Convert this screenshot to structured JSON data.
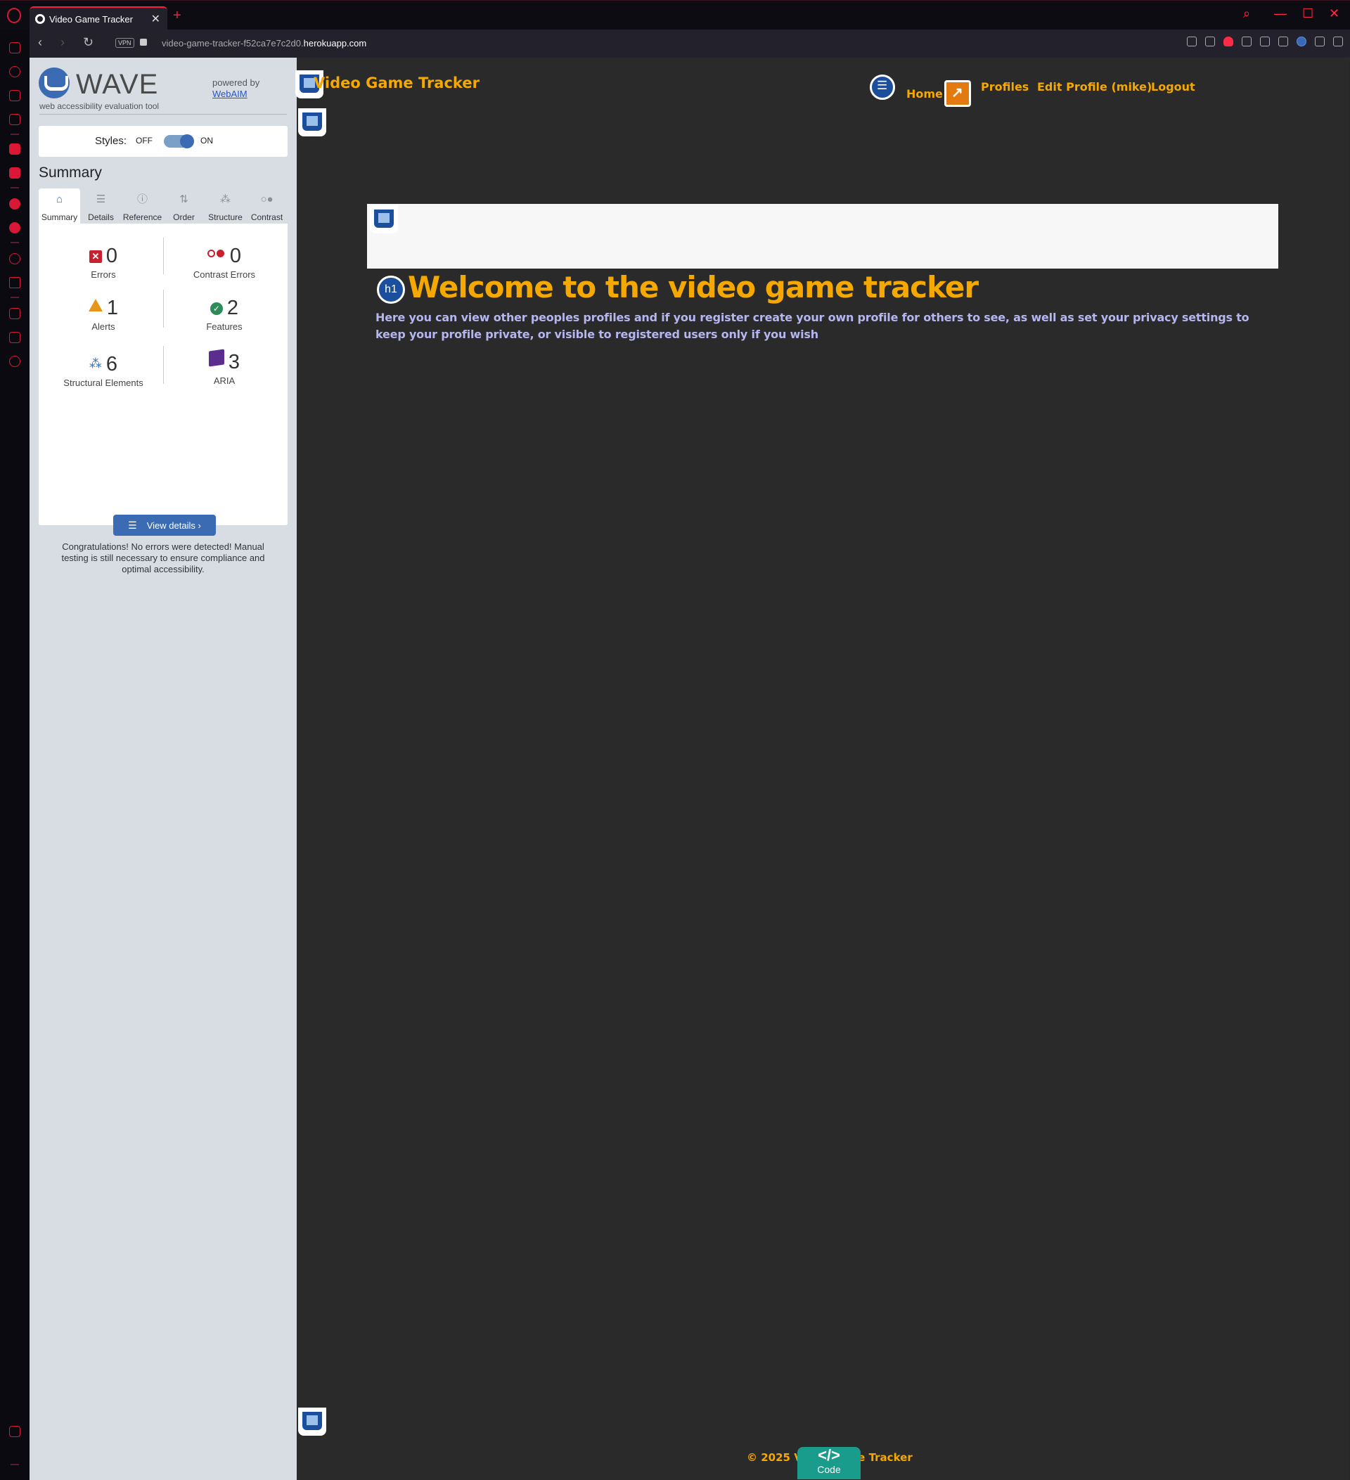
{
  "browser": {
    "tab_title": "Video Game Tracker",
    "tab_close": "✕",
    "new_tab": "+",
    "url_prefix": "video-game-tracker-f52ca7e7c2d0.",
    "url_domain": "herokuapp.com",
    "vpn_label": "VPN",
    "back": "‹",
    "forward": "›",
    "reload": "↻",
    "win_search": "⌕",
    "win_min": "—",
    "win_max": "☐",
    "win_close": "✕",
    "accent": "#ff1b3d"
  },
  "wave": {
    "title": "WAVE",
    "subtitle": "web accessibility evaluation tool",
    "powered_by": "powered by",
    "webaim": "WebAIM",
    "styles_label": "Styles:",
    "styles_off": "OFF",
    "styles_on": "ON",
    "summary_heading": "Summary",
    "tabs": [
      {
        "label": "Summary",
        "icon": "home-icon",
        "glyph": "⌂"
      },
      {
        "label": "Details",
        "icon": "list-icon",
        "glyph": "☰"
      },
      {
        "label": "Reference",
        "icon": "info-icon",
        "glyph": "ⓘ"
      },
      {
        "label": "Order",
        "icon": "order-icon",
        "glyph": "⇅"
      },
      {
        "label": "Structure",
        "icon": "structure-icon",
        "glyph": "⁂"
      },
      {
        "label": "Contrast",
        "icon": "contrast-icon",
        "glyph": "○●"
      }
    ],
    "stats": {
      "errors": {
        "value": "0",
        "label": "Errors",
        "icon_glyph": "✕"
      },
      "contrast_errors": {
        "value": "0",
        "label": "Contrast Errors"
      },
      "alerts": {
        "value": "1",
        "label": "Alerts"
      },
      "features": {
        "value": "2",
        "label": "Features",
        "icon_glyph": "✓"
      },
      "structural": {
        "value": "6",
        "label": "Structural Elements",
        "icon_glyph": "⁂"
      },
      "aria": {
        "value": "3",
        "label": "ARIA"
      }
    },
    "view_details": "View details ›",
    "view_details_icon": "☰",
    "congrats": "Congratulations! No errors were detected! Manual testing is still necessary to ensure compliance and optimal accessibility.",
    "accent": "#3b6bb2"
  },
  "site": {
    "title": "Video Game Tracker",
    "nav": {
      "home": "Home",
      "profiles": "Profiles",
      "edit_profile": "Edit Profile (mike)",
      "logout": "Logout"
    },
    "h1_badge": "h1",
    "heading": "Welcome to the video game tracker",
    "intro": "Here you can view other peoples profiles and if you register create your own profile for others to see, as well as set your privacy settings to keep your profile private, or visible to registered users only if you wish",
    "footer": "© 2025 Video Game Tracker",
    "code_glyph": "</>",
    "code_label": "Code",
    "accent": "#f5a800",
    "background": "#2a2a2a"
  }
}
